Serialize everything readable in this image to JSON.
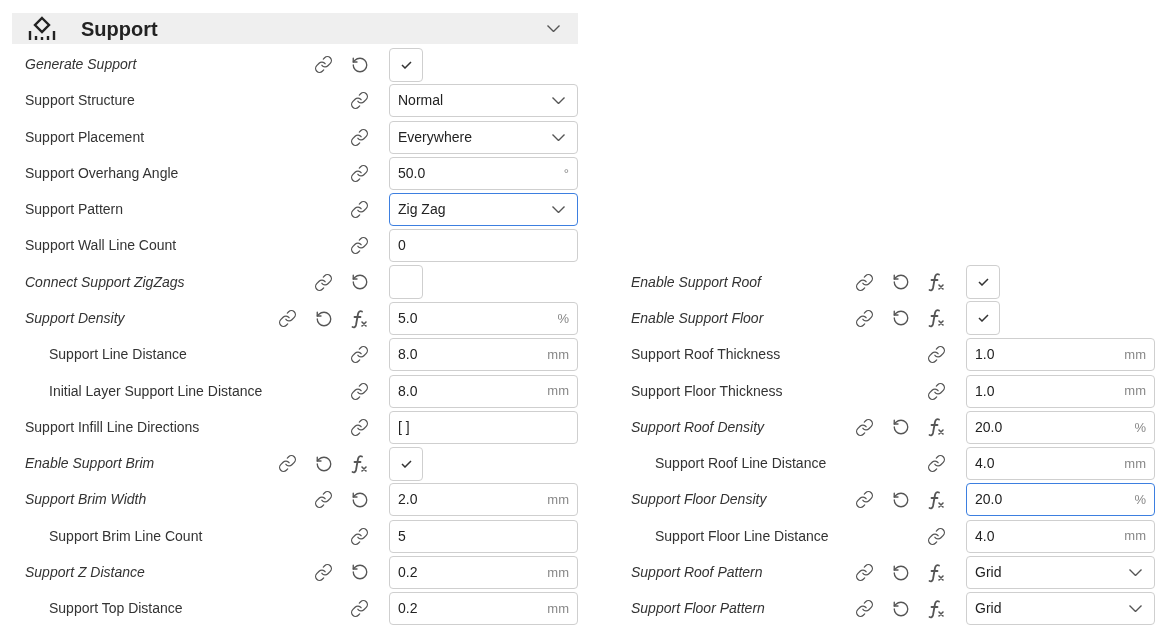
{
  "section": {
    "title": "Support",
    "expanded": true
  },
  "left_rows": [
    {
      "label": "Generate Support",
      "modified": true,
      "formula": false,
      "control": {
        "kind": "checkbox",
        "checked": true
      }
    },
    {
      "label": "Support Structure",
      "modified": false,
      "formula": false,
      "control": {
        "kind": "select",
        "value": "Normal",
        "focused": false
      }
    },
    {
      "label": "Support Placement",
      "modified": false,
      "formula": false,
      "control": {
        "kind": "select",
        "value": "Everywhere",
        "focused": false
      }
    },
    {
      "label": "Support Overhang Angle",
      "modified": false,
      "formula": false,
      "control": {
        "kind": "number",
        "value": "50.0",
        "unit": "°",
        "focused": false
      }
    },
    {
      "label": "Support Pattern",
      "modified": false,
      "formula": false,
      "control": {
        "kind": "select",
        "value": "Zig Zag",
        "focused": true
      }
    },
    {
      "label": "Support Wall Line Count",
      "modified": false,
      "formula": false,
      "control": {
        "kind": "number",
        "value": "0",
        "focused": false
      }
    },
    {
      "label": "Connect Support ZigZags",
      "modified": true,
      "formula": false,
      "control": {
        "kind": "checkbox",
        "checked": false
      }
    },
    {
      "label": "Support Density",
      "modified": true,
      "formula": true,
      "control": {
        "kind": "number",
        "value": "5.0",
        "unit": "%",
        "focused": false
      },
      "children": [
        {
          "label": "Support Line Distance",
          "modified": false,
          "formula": false,
          "control": {
            "kind": "number",
            "value": "8.0",
            "unit": "mm",
            "focused": false
          }
        },
        {
          "label": "Initial Layer Support Line Distance",
          "modified": false,
          "formula": false,
          "control": {
            "kind": "number",
            "value": "8.0",
            "unit": "mm",
            "focused": false
          }
        }
      ]
    },
    {
      "label": "Support Infill Line Directions",
      "modified": false,
      "formula": false,
      "control": {
        "kind": "number",
        "value": "[ ]",
        "focused": false
      }
    },
    {
      "label": "Enable Support Brim",
      "modified": true,
      "formula": true,
      "control": {
        "kind": "checkbox",
        "checked": true
      }
    },
    {
      "label": "Support Brim Width",
      "modified": true,
      "formula": false,
      "control": {
        "kind": "number",
        "value": "2.0",
        "unit": "mm",
        "focused": false
      },
      "children": [
        {
          "label": "Support Brim Line Count",
          "modified": false,
          "formula": false,
          "control": {
            "kind": "number",
            "value": "5",
            "focused": false
          }
        }
      ]
    },
    {
      "label": "Support Z Distance",
      "modified": true,
      "formula": false,
      "control": {
        "kind": "number",
        "value": "0.2",
        "unit": "mm",
        "focused": false
      },
      "children": [
        {
          "label": "Support Top Distance",
          "modified": false,
          "formula": false,
          "control": {
            "kind": "number",
            "value": "0.2",
            "unit": "mm",
            "focused": false
          }
        }
      ]
    }
  ],
  "right_rows": [
    {
      "label": "Enable Support Roof",
      "modified": true,
      "formula": true,
      "control": {
        "kind": "checkbox",
        "checked": true
      }
    },
    {
      "label": "Enable Support Floor",
      "modified": true,
      "formula": true,
      "control": {
        "kind": "checkbox",
        "checked": true
      }
    },
    {
      "label": "Support Roof Thickness",
      "modified": false,
      "formula": false,
      "control": {
        "kind": "number",
        "value": "1.0",
        "unit": "mm",
        "focused": false
      }
    },
    {
      "label": "Support Floor Thickness",
      "modified": false,
      "formula": false,
      "control": {
        "kind": "number",
        "value": "1.0",
        "unit": "mm",
        "focused": false
      }
    },
    {
      "label": "Support Roof Density",
      "modified": true,
      "formula": true,
      "control": {
        "kind": "number",
        "value": "20.0",
        "unit": "%",
        "focused": false
      },
      "children": [
        {
          "label": "Support Roof Line Distance",
          "modified": false,
          "formula": false,
          "control": {
            "kind": "number",
            "value": "4.0",
            "unit": "mm",
            "focused": false
          }
        }
      ]
    },
    {
      "label": "Support Floor Density",
      "modified": true,
      "formula": true,
      "control": {
        "kind": "number",
        "value": "20.0",
        "unit": "%",
        "focused": true
      },
      "children": [
        {
          "label": "Support Floor Line Distance",
          "modified": false,
          "formula": false,
          "control": {
            "kind": "number",
            "value": "4.0",
            "unit": "mm",
            "focused": false
          }
        }
      ]
    },
    {
      "label": "Support Roof Pattern",
      "modified": true,
      "formula": true,
      "control": {
        "kind": "select",
        "value": "Grid",
        "focused": false
      }
    },
    {
      "label": "Support Floor Pattern",
      "modified": true,
      "formula": true,
      "control": {
        "kind": "select",
        "value": "Grid",
        "focused": false
      }
    }
  ]
}
